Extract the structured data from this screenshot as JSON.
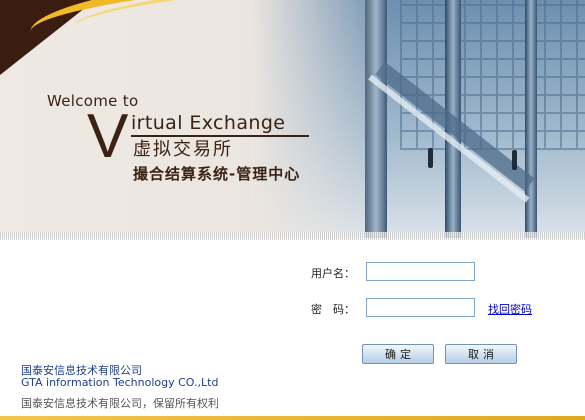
{
  "banner": {
    "welcome": "Welcome to",
    "title_v": "V",
    "title_en": "irtual Exchange",
    "title_cn": "虚拟交易所",
    "subtitle": "撮合结算系统-管理中心"
  },
  "form": {
    "username_label": "用户名：",
    "username_value": "",
    "password_label": "密　码：",
    "password_value": "",
    "forgot_link": "找回密码",
    "ok_button": "确定",
    "cancel_button": "取消"
  },
  "company": {
    "name_cn": "国泰安信息技术有限公司",
    "name_en": "GTA information Technology CO.,Ltd",
    "copyright": "国泰安信息技术有限公司，保留所有权利"
  },
  "colors": {
    "brand_brown": "#3b2314",
    "accent_gold": "#f1b926",
    "link_blue": "#0000cc",
    "company_blue": "#1d3f8f"
  }
}
